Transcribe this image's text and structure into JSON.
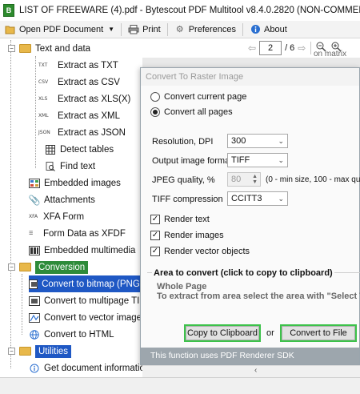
{
  "window": {
    "title": "LIST OF FREEWARE (4).pdf - Bytescout PDF Multitool v8.4.0.2820 (NON-COMMERCIAL USE O"
  },
  "toolbar": {
    "open_label": "Open PDF Document",
    "print_label": "Print",
    "preferences_label": "Preferences",
    "about_label": "About"
  },
  "viewer": {
    "page_value": "2",
    "page_total": "/ 6",
    "background_snippet": "on matrix"
  },
  "tree": {
    "text_and_data": "Text and data",
    "items": [
      {
        "tag": "TXT",
        "label": "Extract as TXT"
      },
      {
        "tag": "CSV",
        "label": "Extract as CSV"
      },
      {
        "tag": "XLS",
        "label": "Extract as XLS(X)"
      },
      {
        "tag": "XML",
        "label": "Extract as XML"
      },
      {
        "tag": "JSON",
        "label": "Extract as JSON"
      },
      {
        "tag": "",
        "label": "Detect tables"
      },
      {
        "tag": "",
        "label": "Find text"
      }
    ],
    "embedded_images": "Embedded images",
    "attachments": "Attachments",
    "xfa_form": "XFA Form",
    "form_data_xfdf": "Form Data as XFDF",
    "embedded_multimedia": "Embedded multimedia",
    "conversion": "Conversion",
    "conversion_items": [
      "Convert to bitmap (PNG,",
      "Convert to multipage TIFF",
      "Convert to vector image (",
      "Convert to HTML"
    ],
    "utilities": "Utilities",
    "get_document_information": "Get document information"
  },
  "dialog": {
    "title": "Convert To Raster Image",
    "radio_current_page": "Convert current page",
    "radio_all_pages": "Convert all pages",
    "resolution_label": "Resolution, DPI",
    "resolution_value": "300",
    "format_label": "Output image format",
    "format_value": "TIFF",
    "jpeg_label": "JPEG quality, %",
    "jpeg_value": "80",
    "jpeg_hint": "(0 - min size, 100 - max qualit",
    "tiff_label": "TIFF compression",
    "tiff_value": "CCITT3",
    "render_text": "Render text",
    "render_images": "Render images",
    "render_vector": "Render vector objects",
    "area_title": "Area to convert (click to copy to clipboard)",
    "area_line1": "Whole Page",
    "area_line2": "To extract from area select the area with \"Select To",
    "copy_button": "Copy to Clipboard",
    "or_text": "or",
    "convert_button": "Convert to File",
    "footer": "This function uses PDF Renderer SDK"
  }
}
